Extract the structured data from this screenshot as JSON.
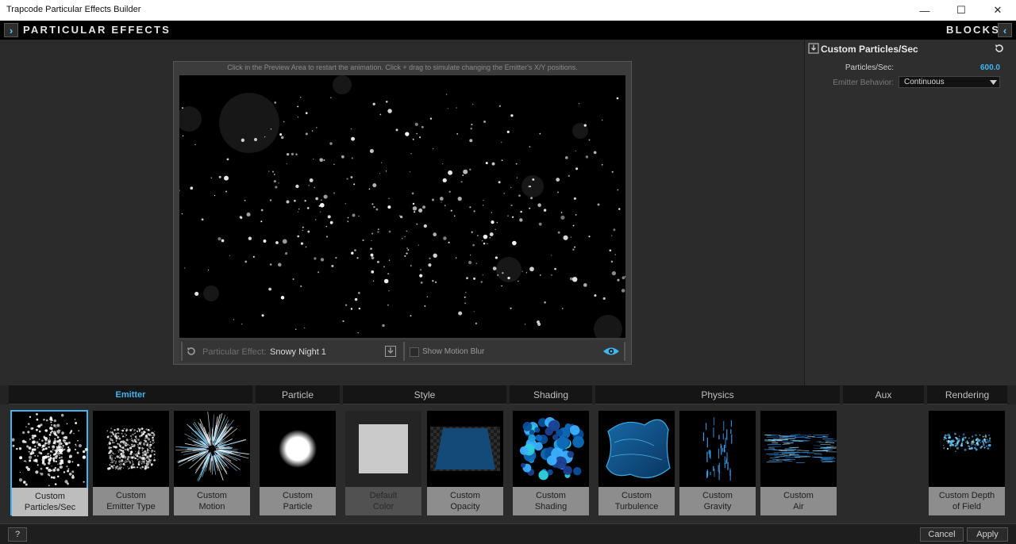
{
  "window": {
    "title": "Trapcode Particular Effects Builder",
    "minimize": "—",
    "maximize": "☐",
    "close": "✕"
  },
  "header": {
    "left_title": "PARTICULAR EFFECTS",
    "right_title": "BLOCKS",
    "left_chevron": "›",
    "right_chevron": "‹"
  },
  "preview": {
    "hint": "Click in the Preview Area to restart the animation. Click + drag to simulate changing the Emitter's X/Y positions.",
    "effect_label": "Particular Effect:",
    "effect_name": "Snowy Night 1",
    "motion_blur_label": "Show Motion Blur",
    "motion_blur_checked": false
  },
  "block": {
    "title": "Custom Particles/Sec",
    "fields": [
      {
        "label": "Particles/Sec:",
        "value": "600.0"
      },
      {
        "label": "Emitter Behavior:",
        "value": "Continuous"
      }
    ]
  },
  "categories": [
    {
      "label": "Emitter",
      "active": true
    },
    {
      "label": "Particle",
      "active": false
    },
    {
      "label": "Style",
      "active": false
    },
    {
      "label": "Shading",
      "active": false
    },
    {
      "label": "Physics",
      "active": false
    },
    {
      "label": "Aux",
      "active": false
    },
    {
      "label": "Rendering",
      "active": false
    }
  ],
  "tiles": [
    {
      "label": "Custom\nParticles/Sec",
      "icon": "particles-sec-thumb",
      "selected": true
    },
    {
      "label": "Custom\nEmitter Type",
      "icon": "emitter-type-thumb"
    },
    {
      "label": "Custom\nMotion",
      "icon": "motion-burst-thumb"
    },
    {
      "label": "Custom\nParticle",
      "icon": "soft-sphere-thumb"
    },
    {
      "label": "Default\nColor",
      "icon": "white-square-thumb",
      "disabled": true
    },
    {
      "label": "Custom\nOpacity",
      "icon": "opacity-trapezoid-thumb"
    },
    {
      "label": "Custom\nShading",
      "icon": "shaded-spheres-thumb"
    },
    {
      "label": "Custom\nTurbulence",
      "icon": "turbulence-sheet-thumb"
    },
    {
      "label": "Custom\nGravity",
      "icon": "gravity-streaks-thumb"
    },
    {
      "label": "Custom\nAir",
      "icon": "air-streaks-thumb"
    },
    {
      "label": "Custom Depth\nof Field",
      "icon": "depth-of-field-thumb"
    }
  ],
  "footer": {
    "help": "?",
    "cancel": "Cancel",
    "apply": "Apply"
  },
  "colors": {
    "accent": "#3fb6f2",
    "tile_label_bg": "#8d8d8d"
  }
}
